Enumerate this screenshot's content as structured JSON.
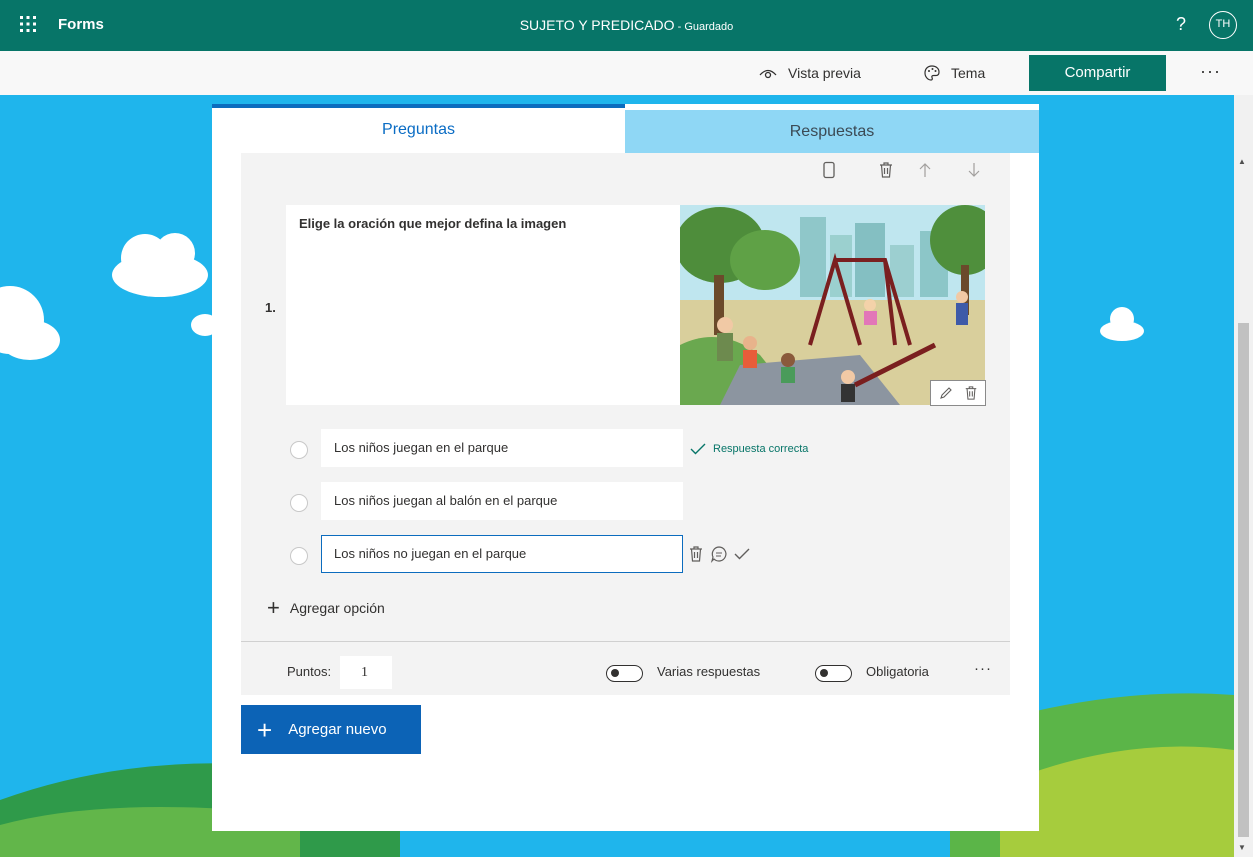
{
  "app": {
    "name": "Forms",
    "form_title": "SUJETO Y PREDICADO",
    "title_separator": " - ",
    "save_status": "Guardado",
    "help": "?",
    "user_initials": "TH"
  },
  "commands": {
    "preview": "Vista previa",
    "theme": "Tema",
    "share": "Compartir",
    "more": "···"
  },
  "tabs": {
    "questions": "Preguntas",
    "responses": "Respuestas"
  },
  "question": {
    "number": "1.",
    "title": "Elige la oración que mejor defina la imagen",
    "options": [
      {
        "text": "Los niños juegan en el parque",
        "correct": true
      },
      {
        "text": "Los niños juegan al balón en el parque",
        "correct": false
      },
      {
        "text": "Los niños no juegan en el parque",
        "correct": false
      }
    ],
    "correct_label": "Respuesta correcta",
    "add_option": "Agregar opción",
    "points_label": "Puntos:",
    "points_value": "1",
    "multiple_answers_label": "Varias respuestas",
    "multiple_answers_on": false,
    "required_label": "Obligatoria",
    "required_on": false,
    "more": "···"
  },
  "add_new": "Agregar nuevo",
  "colors": {
    "brand_teal": "#077568",
    "accent_blue": "#0c6cbe",
    "sky": "#1fb5ec",
    "responses_tab": "#8fd7f5"
  }
}
